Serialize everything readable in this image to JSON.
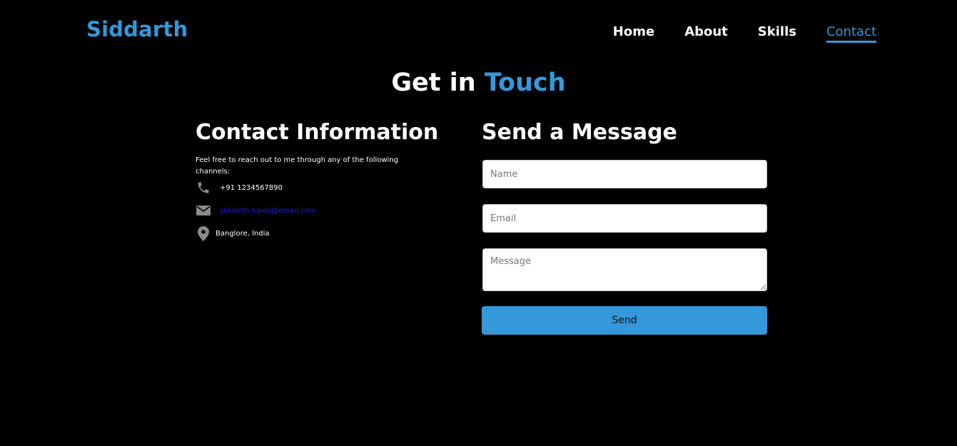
{
  "header": {
    "brand": "Siddarth",
    "nav": [
      {
        "label": "Home",
        "active": false
      },
      {
        "label": "About",
        "active": false
      },
      {
        "label": "Skills",
        "active": false
      },
      {
        "label": "Contact",
        "active": true
      }
    ]
  },
  "page": {
    "title_prefix": "Get in",
    "title_accent": "Touch"
  },
  "contact_info": {
    "title": "Contact Information",
    "intro": "Feel free to reach out to me through any of the following channels:",
    "phone": "+91 1234567890",
    "email": "siddarth.naidu@email.com",
    "location": "Banglore, India",
    "icons": [
      "phone-icon",
      "envelope-icon",
      "map-pin-icon"
    ]
  },
  "form": {
    "title": "Send a Message",
    "name_placeholder": "Name",
    "email_placeholder": "Email",
    "message_placeholder": "Message",
    "send_label": "Send"
  },
  "colors": {
    "background": "#000000",
    "accent": "#3498db",
    "email_link": "#1a1aff",
    "icon_gray": "#8a8a8a"
  }
}
